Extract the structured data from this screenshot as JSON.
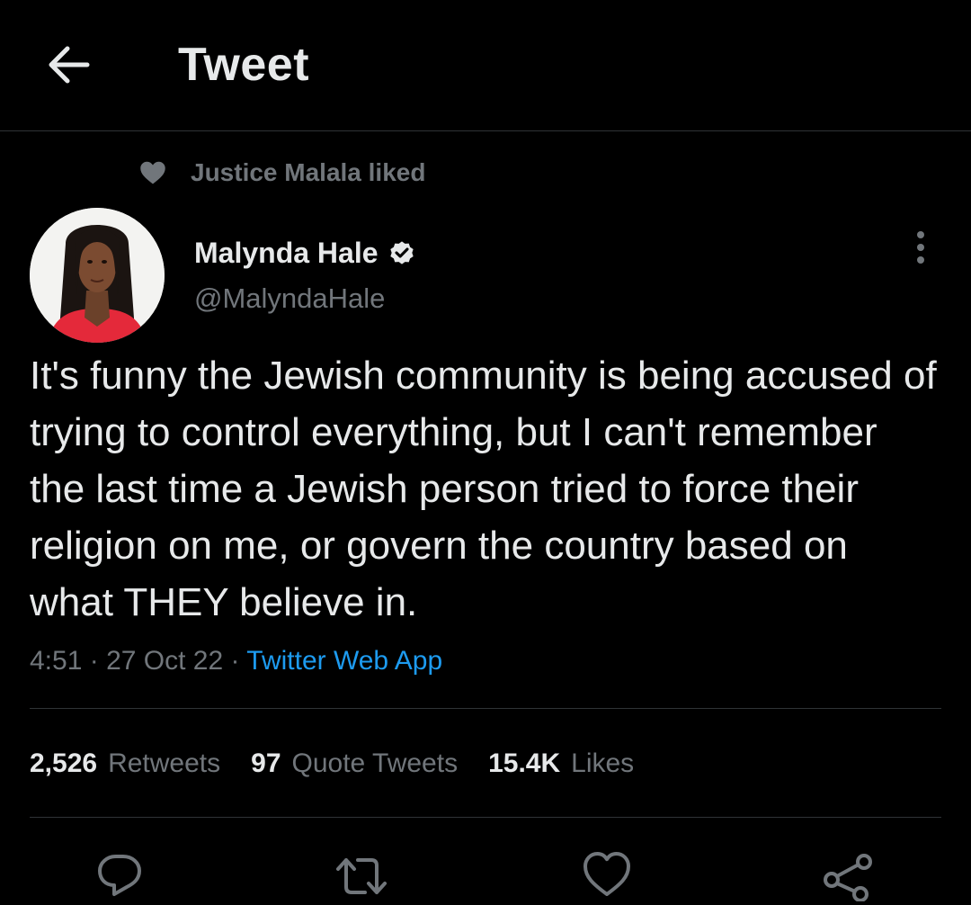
{
  "header": {
    "title": "Tweet",
    "back_icon": "arrow-left-icon"
  },
  "social_context": {
    "icon": "heart-filled-icon",
    "text": "Justice Malala liked"
  },
  "author": {
    "name": "Malynda Hale",
    "handle": "@MalyndaHale",
    "verified": true
  },
  "tweet": {
    "text": "It's funny the Jewish community is being accused of trying to control everything, but I can't remember the last time a Jewish person tried to force their religion on me, or govern the country based on what THEY believe in.",
    "time": "4:51",
    "separator": "·",
    "date": "27 Oct 22",
    "source": "Twitter Web App"
  },
  "stats": {
    "retweets": {
      "count": "2,526",
      "label": "Retweets"
    },
    "quotes": {
      "count": "97",
      "label": "Quote Tweets"
    },
    "likes": {
      "count": "15.4K",
      "label": "Likes"
    }
  },
  "actions": [
    "reply-icon",
    "retweet-icon",
    "like-icon",
    "share-icon"
  ],
  "colors": {
    "background": "#000000",
    "text_primary": "#e7e9ea",
    "text_secondary": "#71767b",
    "link": "#1d9bf0",
    "divider": "#2f3336"
  }
}
